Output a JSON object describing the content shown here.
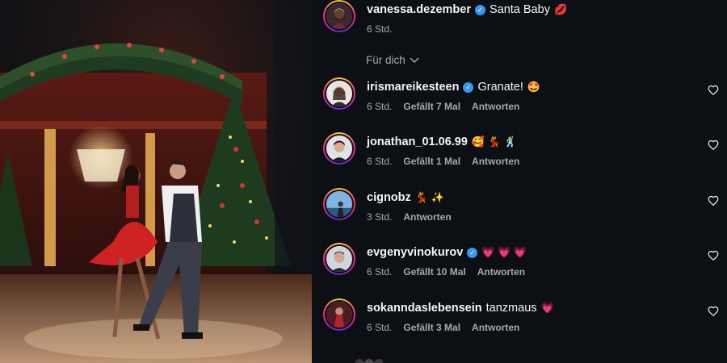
{
  "top_comment": {
    "username": "vanessa.dezember",
    "verified": true,
    "text": "Santa Baby",
    "emojis": "💋",
    "time": "6 Std."
  },
  "for_you_label": "Für dich",
  "comments": [
    {
      "username": "irismareikesteen",
      "verified": true,
      "text": "Granate!",
      "emojis": "🤩",
      "time": "6 Std.",
      "likes": "Gefällt 7 Mal",
      "reply": "Antworten"
    },
    {
      "username": "jonathan_01.06.99",
      "verified": false,
      "text": "",
      "emojis": "🥰 💃 🕺",
      "time": "6 Std.",
      "likes": "Gefällt 1 Mal",
      "reply": "Antworten"
    },
    {
      "username": "cignobz",
      "verified": false,
      "text": "",
      "emojis": "💃 ✨",
      "time": "3 Std.",
      "likes": "",
      "reply": "Antworten"
    },
    {
      "username": "evgenyvinokurov",
      "verified": true,
      "text": "",
      "emojis": "💗 💗 💗",
      "time": "6 Std.",
      "likes": "Gefällt 10 Mal",
      "reply": "Antworten"
    },
    {
      "username": "sokanndaslebensein",
      "verified": false,
      "text": "tanzmaus",
      "emojis": "💗",
      "time": "6 Std.",
      "likes": "Gefällt 3 Mal",
      "reply": "Antworten"
    }
  ],
  "colors": {
    "background": "#0c0f14",
    "text_primary": "#f5f5f5",
    "text_secondary": "#a8a8a8",
    "verified_blue": "#3797f0"
  }
}
